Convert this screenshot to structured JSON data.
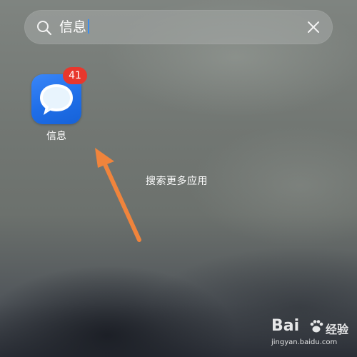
{
  "search": {
    "query": "信息",
    "icons": {
      "search": "search-icon",
      "clear": "close-icon"
    },
    "caret_color": "#3a8ef0"
  },
  "results": [
    {
      "label": "信息",
      "icon": "message-bubble-icon",
      "badge": "41",
      "icon_color": "#2f7cf2",
      "badge_color": "#e8372d"
    }
  ],
  "annotation": {
    "text": "搜索更多应用",
    "arrow_color": "#f0843c"
  },
  "watermark": {
    "brand": "Bai",
    "brand_suffix": "经验",
    "url": "jingyan.baidu.com"
  }
}
